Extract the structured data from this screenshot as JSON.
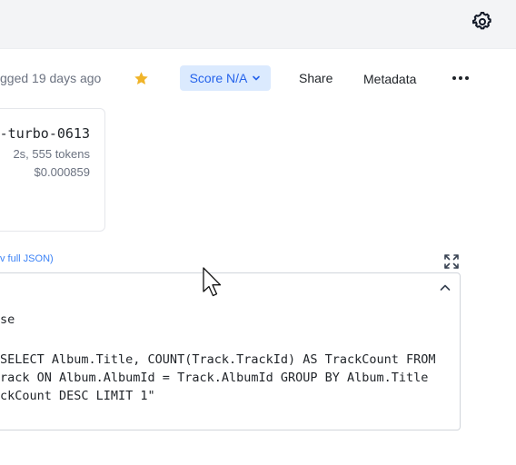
{
  "header": {
    "settings_icon": "gear-icon"
  },
  "meta": {
    "logged_text": "gged 19 days ago",
    "star_icon": "star-icon",
    "star_color": "#f0b429",
    "score_label": "Score N/A",
    "score_chevron_icon": "chevron-down-icon",
    "share_label": "Share",
    "metadata_label": "Metadata",
    "more_icon": "more-horizontal-icon"
  },
  "model_card": {
    "name": "-turbo-0613",
    "stats": "2s, 555 tokens",
    "cost": "$0.000859"
  },
  "output": {
    "view_json_link": "v full JSON)",
    "expand_icon": "expand-icon",
    "collapse_icon": "chevron-up-icon",
    "section_label": "se",
    "code_lines": [
      "SELECT Album.Title, COUNT(Track.TrackId) AS TrackCount FROM",
      "rack ON Album.AlbumId = Track.AlbumId GROUP BY Album.Title",
      "ckCount DESC LIMIT 1\""
    ]
  },
  "colors": {
    "accent": "#2563eb",
    "accent_bg": "#dbeafe",
    "link": "#3b82f6",
    "topbar_bg": "#f3f4f6"
  }
}
